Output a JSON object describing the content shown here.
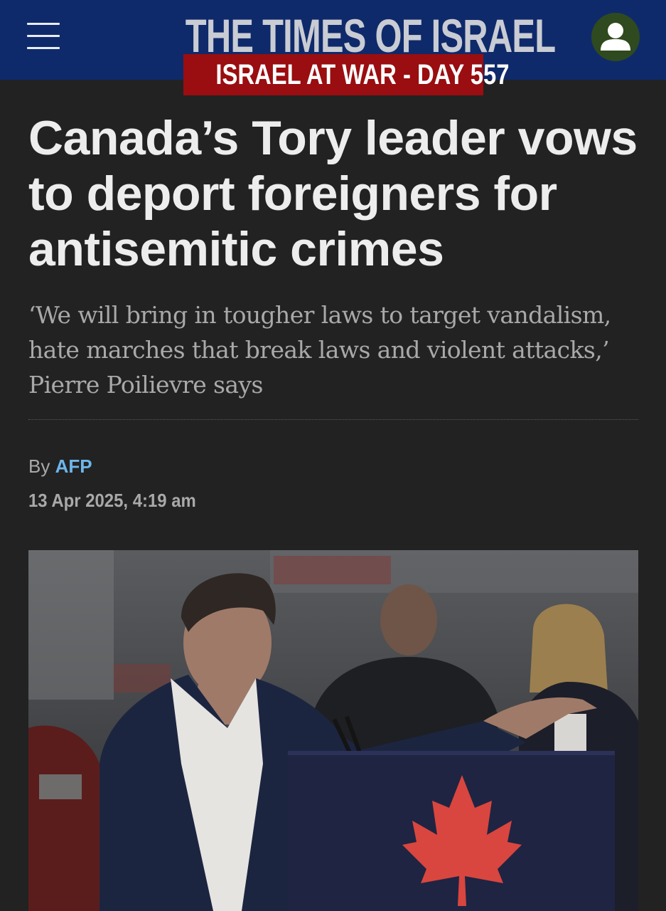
{
  "header": {
    "menu_icon": "hamburger-menu-icon",
    "logo_text": "THE TIMES OF ISRAEL",
    "banner_text": "ISRAEL AT WAR - DAY 557",
    "account_icon": "user-account-icon",
    "colors": {
      "bar": "#0f2a6b",
      "banner": "#9a0d10",
      "avatar": "#2f4a1e"
    }
  },
  "article": {
    "headline": "Canada’s Tory leader vows to deport foreigners for antisemitic crimes",
    "subheadline": "‘We will bring in tougher laws to target vandalism, hate marches that break laws and violent attacks,’ Pierre Poilievre says",
    "byline_prefix": "By",
    "author": "AFP",
    "date": "13 Apr 2025, 4:19 am",
    "colors": {
      "background": "#222222",
      "headline": "#ededed",
      "author_link": "#6eb6ea"
    }
  }
}
